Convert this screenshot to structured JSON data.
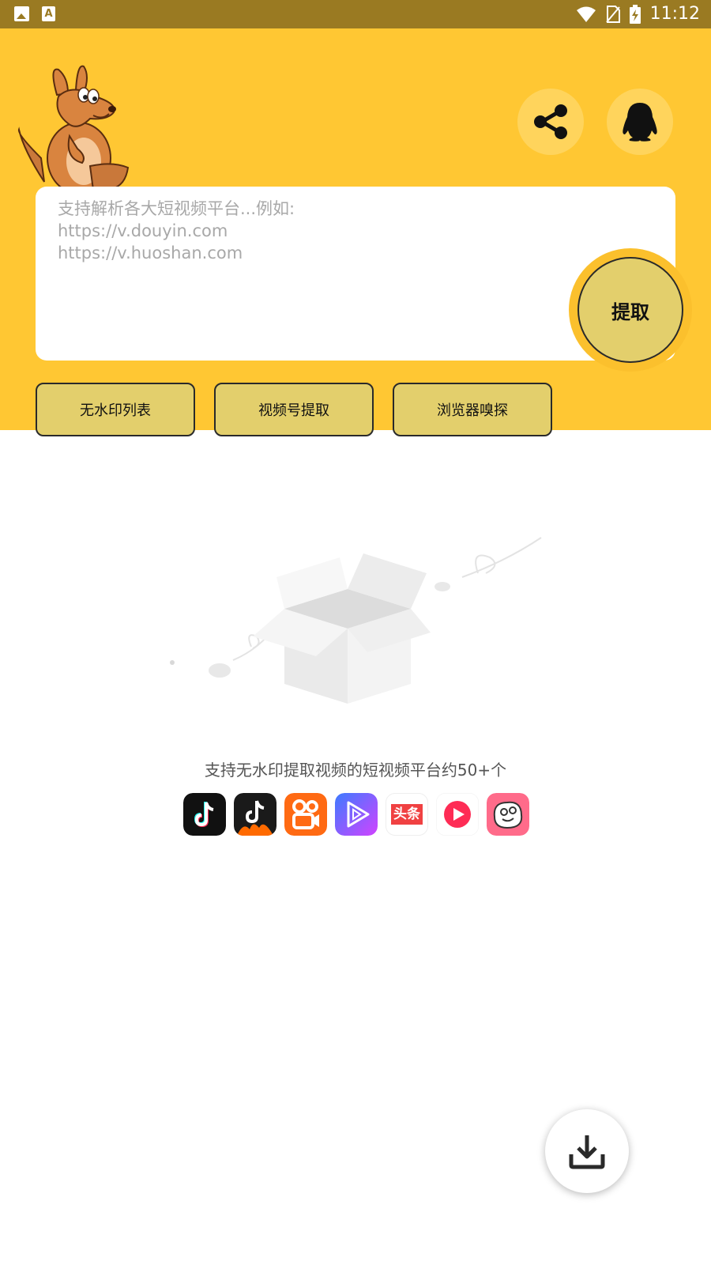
{
  "status_bar": {
    "time": "11:12",
    "left_icons": [
      "image-icon",
      "text-a-icon"
    ],
    "right_icons": [
      "wifi-icon",
      "no-sim-icon",
      "battery-charging-icon"
    ],
    "a_glyph": "A"
  },
  "header": {
    "background_color": "#ffc733",
    "mascot": "kangaroo-mascot",
    "share_icon": "share-icon",
    "qq_icon": "qq-penguin-icon"
  },
  "input": {
    "value": "",
    "placeholder": "支持解析各大短视频平台...例如:\nhttps://v.douyin.com\nhttps://v.huoshan.com"
  },
  "actions": {
    "extract_label": "提取",
    "buttons": [
      {
        "label": "无水印列表"
      },
      {
        "label": "视频号提取"
      },
      {
        "label": "浏览器嗅探"
      }
    ]
  },
  "empty_state": {
    "illustration": "open-box-illustration",
    "support_text": "支持无水印提取视频的短视频平台约50+个"
  },
  "platforms": [
    {
      "name": "douyin",
      "icon": "douyin-icon",
      "color": "#111111"
    },
    {
      "name": "douyin-huoshan",
      "icon": "douyin-huoshan-icon",
      "color": "#1a1a1a"
    },
    {
      "name": "kuaishou",
      "icon": "kuaishou-icon",
      "color": "#ff6a13"
    },
    {
      "name": "weishi",
      "icon": "weishi-icon",
      "color": "#6a4cff"
    },
    {
      "name": "toutiao",
      "icon": "toutiao-icon",
      "color": "#f04142",
      "text": "头条"
    },
    {
      "name": "xigua",
      "icon": "xigua-icon",
      "color": "#fe2c55"
    },
    {
      "name": "pipixia",
      "icon": "pipixia-icon",
      "color": "#ff6b8a"
    }
  ],
  "fab": {
    "icon": "download-icon"
  }
}
